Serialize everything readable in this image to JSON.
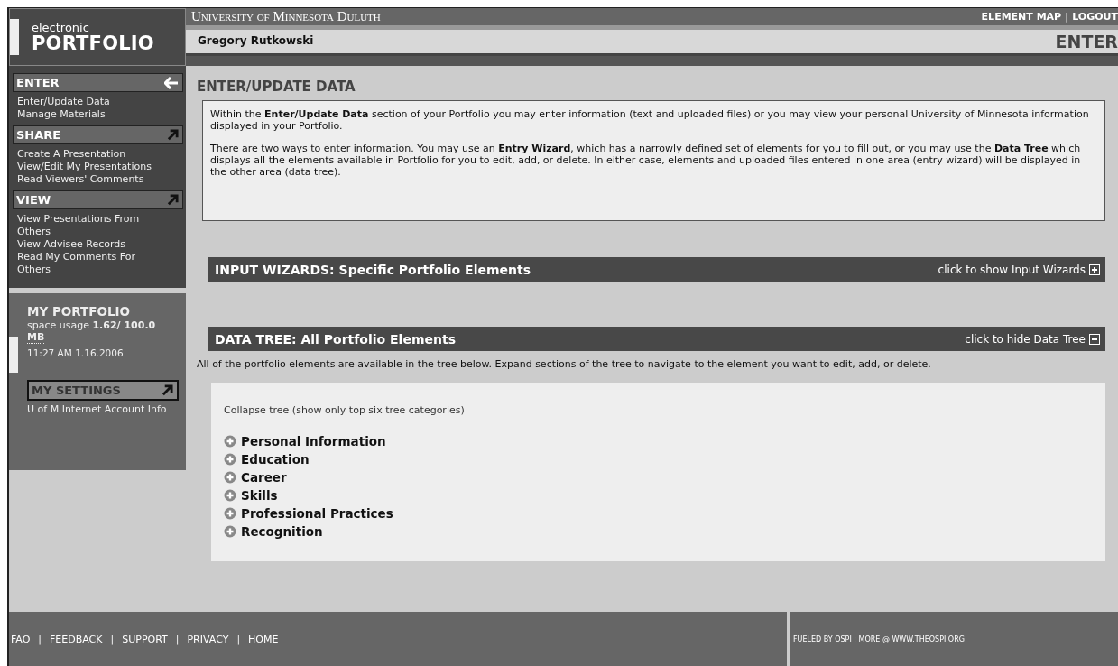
{
  "header": {
    "logo_small": "electronic",
    "logo_big": "PORTFOLIO",
    "university": "University of Minnesota Duluth",
    "links": [
      "ELEMENT MAP",
      "LOGOUT"
    ],
    "link_separator": "|",
    "user": "Gregory Rutkowski",
    "section": "ENTER"
  },
  "sidebar": {
    "sections": [
      {
        "title": "ENTER",
        "selected": true,
        "items": [
          "Enter/Update Data",
          "Manage Materials"
        ]
      },
      {
        "title": "SHARE",
        "selected": false,
        "items": [
          "Create A Presentation",
          "View/Edit My Presentations",
          "Read Viewers' Comments"
        ]
      },
      {
        "title": "VIEW",
        "selected": false,
        "items": [
          "View Presentations From Others",
          "View Advisee Records",
          "Read My Comments For Others"
        ]
      }
    ],
    "my_portfolio": {
      "title": "MY PORTFOLIO",
      "usage_label": "space usage",
      "usage": "1.62/ 100.0",
      "unit": "MB",
      "timestamp": "11:27 AM 1.16.2006"
    },
    "settings": {
      "title": "MY SETTINGS",
      "items": [
        "U of M Internet Account Info"
      ]
    }
  },
  "main": {
    "title": "ENTER/UPDATE DATA",
    "intro": [
      "Within the **Enter/Update Data** section of your Portfolio you may enter information (text and uploaded files) or you may view your personal University of Minnesota information displayed in your Portfolio.",
      "There are two ways to enter information. You may use an **Entry Wizard**, which has a narrowly defined set of elements for you to fill out, or you may use the **Data Tree** which displays all the elements available in Portfolio for you to edit, add, or delete. In either case, elements and uploaded files entered in one area (entry wizard) will be displayed in the other area (data tree)."
    ],
    "panels": [
      {
        "title": "INPUT WIZARDS: Specific Portfolio Elements",
        "toggle": "click to show Input Wizards",
        "expanded": false
      },
      {
        "title": "DATA TREE: All Portfolio Elements",
        "toggle": "click to hide Data Tree",
        "expanded": true,
        "description": "All of the portfolio elements are available in the tree below. Expand sections of the tree to navigate to the element you want to edit, add, or delete.",
        "tree": {
          "collapse_link": "Collapse tree (show only top six tree categories)",
          "items": [
            {
              "label": "Personal Information",
              "expanded": false
            },
            {
              "label": "Education",
              "expanded": false
            },
            {
              "label": "Career",
              "expanded": false
            },
            {
              "label": "Skills",
              "expanded": false
            },
            {
              "label": "Professional Practices",
              "expanded": false
            },
            {
              "label": "Recognition",
              "expanded": false
            }
          ]
        }
      }
    ]
  },
  "footer": {
    "links": [
      "FAQ",
      "FEEDBACK",
      "SUPPORT",
      "PRIVACY",
      "HOME"
    ],
    "link_separator": "|",
    "credit": "FUELED BY OSPI : MORE @ WWW.THEOSPI.ORG"
  }
}
